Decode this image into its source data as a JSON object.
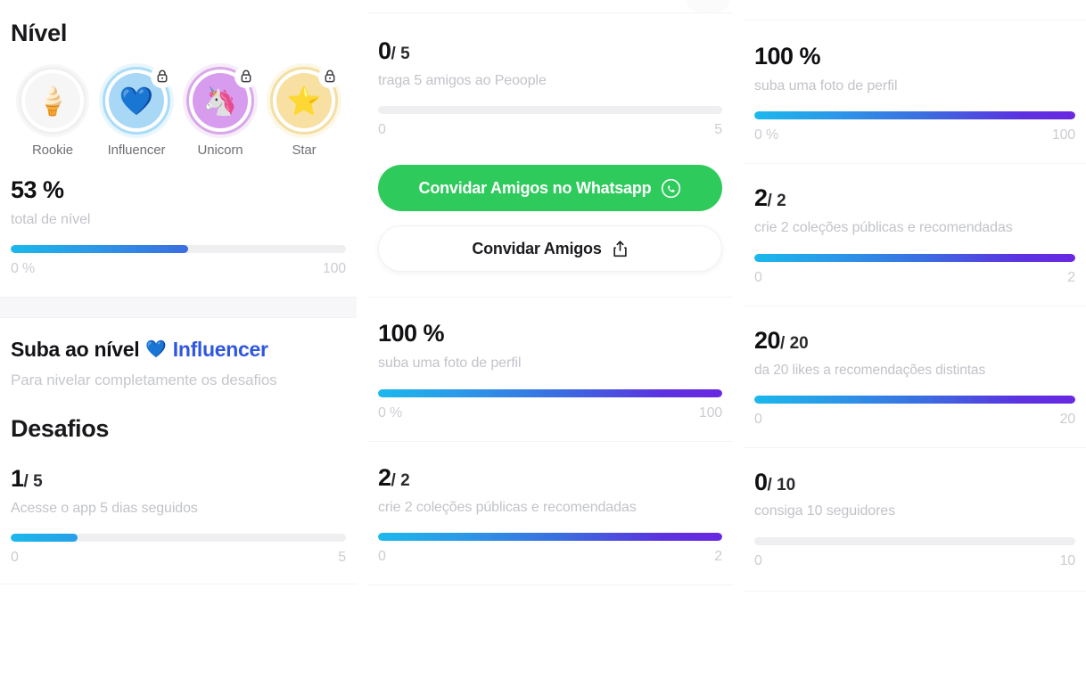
{
  "left": {
    "level_heading": "Nível",
    "badges": [
      {
        "label": "Rookie",
        "emoji": "🍦",
        "locked": false,
        "variant": "v-rookie"
      },
      {
        "label": "Influencer",
        "emoji": "💙",
        "locked": true,
        "variant": "v-influencer"
      },
      {
        "label": "Unicorn",
        "emoji": "🦄",
        "locked": true,
        "variant": "v-unicorn"
      },
      {
        "label": "Star",
        "emoji": "⭐",
        "locked": true,
        "variant": "v-star"
      }
    ],
    "total_metric": {
      "value": "53 %",
      "sub": "total de nível",
      "scale_min": "0 %",
      "scale_max": "100",
      "percent": 53
    },
    "levelup": {
      "title_prefix": "Suba ao nível",
      "heart": "💙",
      "level_name": "Influencer",
      "subtitle": "Para nivelar completamente os desafios"
    },
    "challenges_heading": "Desafios",
    "challenge": {
      "value": "1",
      "denominator": "/ 5",
      "sub": "Acesse o app 5 dias seguidos",
      "scale_min": "0",
      "scale_max": "5",
      "percent": 20
    }
  },
  "middle": {
    "cards": [
      {
        "value": "0",
        "denominator": "/ 5",
        "sub": "traga 5 amigos ao Peoople",
        "scale_min": "0",
        "scale_max": "5",
        "percent": 0
      },
      {
        "value": "100 %",
        "denominator": "",
        "sub": "suba uma foto de perfil",
        "scale_min": "0 %",
        "scale_max": "100",
        "percent": 100
      },
      {
        "value": "2",
        "denominator": "/ 2",
        "sub": "crie 2 coleções públicas e recomendadas",
        "scale_min": "0",
        "scale_max": "2",
        "percent": 100
      }
    ],
    "whatsapp_button": "Convidar Amigos no Whatsapp",
    "whatsapp_icon": "whatsapp-icon",
    "invite_button": "Convidar Amigos",
    "invite_icon": "share-icon"
  },
  "right": {
    "cards": [
      {
        "value": "100 %",
        "denominator": "",
        "sub": "suba uma foto de perfil",
        "scale_min": "0 %",
        "scale_max": "100",
        "percent": 100
      },
      {
        "value": "2",
        "denominator": "/ 2",
        "sub": "crie 2 coleções públicas e recomendadas",
        "scale_min": "0",
        "scale_max": "2",
        "percent": 100
      },
      {
        "value": "20",
        "denominator": "/ 20",
        "sub": "da 20 likes a recomendações distintas",
        "scale_min": "0",
        "scale_max": "20",
        "percent": 100
      },
      {
        "value": "0",
        "denominator": "/ 10",
        "sub": "consiga 10 seguidores",
        "scale_min": "0",
        "scale_max": "10",
        "percent": 0
      }
    ]
  },
  "colors": {
    "accent_start": "#1bb8ec",
    "accent_end": "#6a27e2",
    "whatsapp_green": "#2ecb5c",
    "level_link_blue": "#2f56e0",
    "muted_text": "#c2c3c9",
    "heading_text": "#101013"
  }
}
